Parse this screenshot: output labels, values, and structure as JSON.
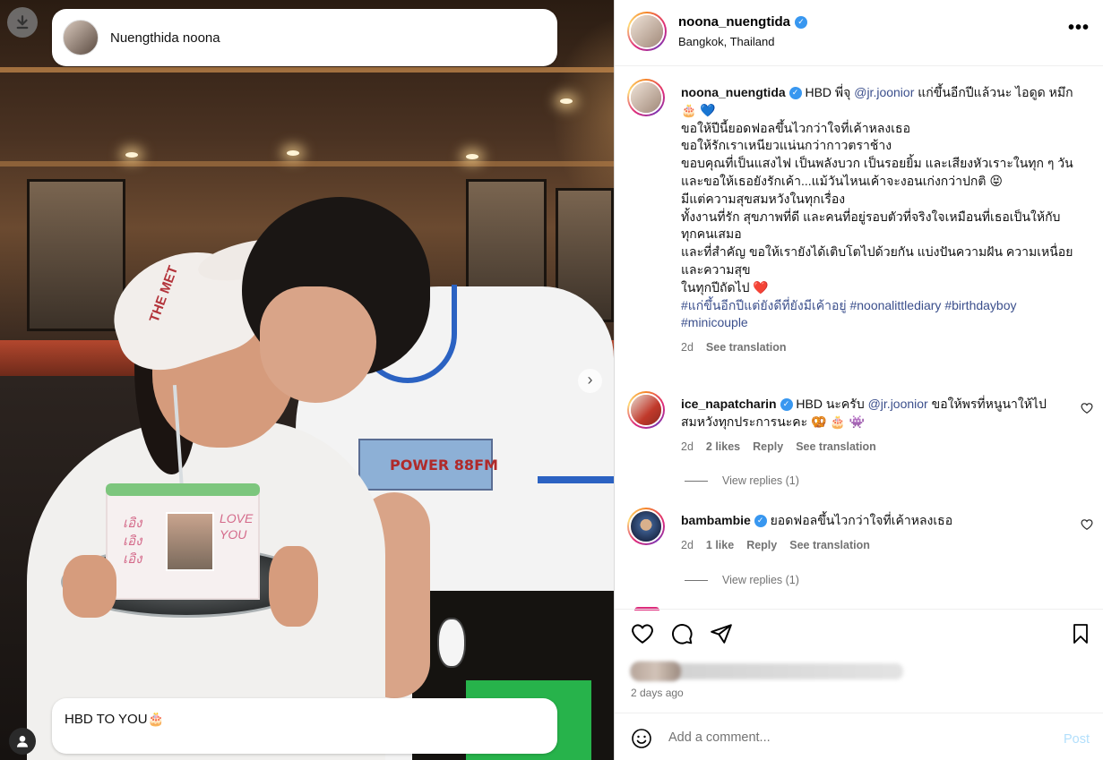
{
  "photo": {
    "story_name": "Nuengthida noona",
    "caption_overlay": "HBD TO YOU🎂",
    "cap_text": "THE MET",
    "cake_left_text": "เอิง เอิง เอิง",
    "cake_right_text": "LOVE YOU",
    "shirt_print": "POWER 88FM"
  },
  "header": {
    "username": "noona_nuengtida",
    "location": "Bangkok, Thailand",
    "more_icon": "more-horizontal-icon"
  },
  "caption": {
    "username": "noona_nuengtida",
    "text_before_mention": "HBD พี่จุ",
    "mention": "@jr.joonior",
    "line1_rest": " แก่ขึ้นอีกปีแล้วนะ ไอดูด หมึก 🎂 💙",
    "line2": "ขอให้ปีนี้ยอดฟอลขึ้นไวกว่าใจที่เค้าหลงเธอ",
    "line3": "ขอให้รักเราเหนียวแน่นกว่ากาวตราช้าง",
    "line4": "ขอบคุณที่เป็นแสงไฟ เป็นพลังบวก เป็นรอยยิ้ม และเสียงหัวเราะในทุก ๆ วัน",
    "line5": "และขอให้เธอยังรักเค้า...แม้วันไหนเค้าจะงอนเก่งกว่าปกติ 😝",
    "line6": "มีแต่ความสุขสมหวังในทุกเรื่อง",
    "line7": "ทั้งงานที่รัก สุขภาพที่ดี และคนที่อยู่รอบตัวที่จริงใจเหมือนที่เธอเป็นให้กับทุกคนเสมอ",
    "line8": "และที่สำคัญ ขอให้เรายังได้เติบโตไปด้วยกัน แบ่งปันความฝัน ความเหนื่อย และความสุข",
    "line9": "ในทุกปีถัดไป ❤️",
    "hashtag1": "#แก่ขึ้นอีกปีแต่ยังดีที่ยังมีเค้าอยู่",
    "hashtag2": "#noonalittlediary",
    "hashtag3": "#birthdayboy",
    "hashtag4": "#minicouple",
    "time": "2d",
    "see_translation": "See translation"
  },
  "comments": [
    {
      "username": "ice_napatcharin",
      "text_before_mention": "HBD นะครับ",
      "mention": "@jr.joonior",
      "text_after_mention": " ขอให้พรที่หนูนาให้ไปสมหวังทุกประการนะคะ 🥨 🎂 👾",
      "time": "2d",
      "likes": "2 likes",
      "reply": "Reply",
      "see_translation": "See translation",
      "view_replies": "View replies (1)"
    },
    {
      "username": "bambambie",
      "text": "ยอดฟอลขึ้นไวกว่าใจที่เค้าหลงเธอ",
      "time": "2d",
      "likes": "1 like",
      "reply": "Reply",
      "see_translation": "See translation",
      "view_replies": "View replies (1)"
    }
  ],
  "actions": {
    "time_ago": "2 days ago"
  },
  "add_comment": {
    "placeholder": "Add a comment...",
    "post_label": "Post",
    "post_color": "#b2dffc"
  },
  "colors": {
    "link": "#3b4f8c",
    "muted": "#737373",
    "verified": "#3897f0"
  }
}
